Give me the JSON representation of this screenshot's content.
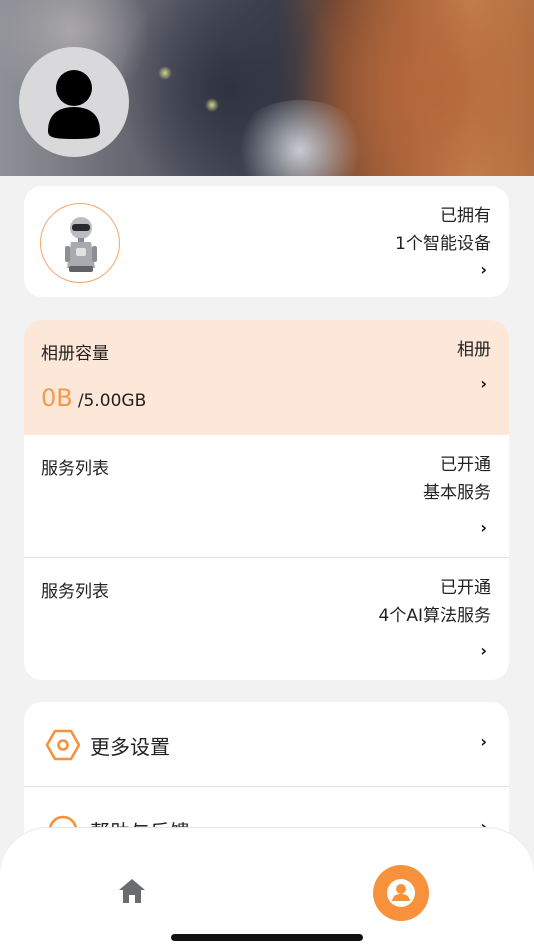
{
  "device": {
    "status": "已拥有",
    "count_text": "1个智能设备"
  },
  "album": {
    "label": "相册容量",
    "right_label": "相册",
    "used": "0B",
    "total": "/5.00GB"
  },
  "services": [
    {
      "label": "服务列表",
      "status": "已开通",
      "detail": "基本服务"
    },
    {
      "label": "服务列表",
      "status": "已开通",
      "detail": "4个AI算法服务"
    }
  ],
  "settings": [
    {
      "label": "更多设置",
      "icon": "hexagon-settings-icon"
    },
    {
      "label": "帮助与反馈",
      "icon": "headset-icon"
    }
  ],
  "tabbar": {
    "items": [
      {
        "icon": "home-icon",
        "active": false
      },
      {
        "icon": "profile-icon",
        "active": true
      }
    ]
  },
  "colors": {
    "accent": "#f7913c",
    "album_bg": "#fde7d9"
  }
}
